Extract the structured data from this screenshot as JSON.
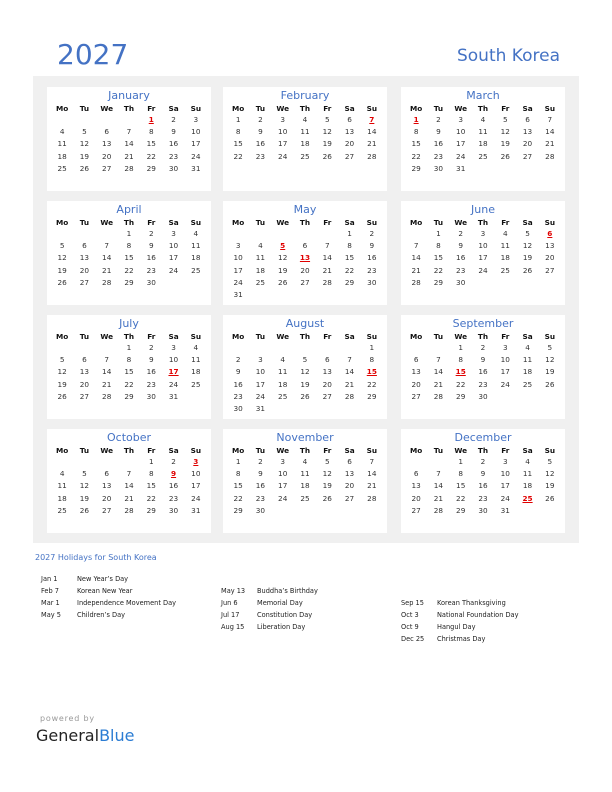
{
  "header": {
    "year": "2027",
    "country": "South Korea"
  },
  "colors": {
    "accent": "#4472c4",
    "holiday": "#e00000",
    "panel_bg": "#f0f0f0"
  },
  "weekdays": [
    "Mo",
    "Tu",
    "We",
    "Th",
    "Fr",
    "Sa",
    "Su"
  ],
  "months": [
    {
      "name": "January",
      "first_weekday": 4,
      "days": 31,
      "holidays": [
        1
      ]
    },
    {
      "name": "February",
      "first_weekday": 0,
      "days": 28,
      "holidays": [
        7
      ]
    },
    {
      "name": "March",
      "first_weekday": 0,
      "days": 31,
      "holidays": [
        1
      ]
    },
    {
      "name": "April",
      "first_weekday": 3,
      "days": 30,
      "holidays": []
    },
    {
      "name": "May",
      "first_weekday": 5,
      "days": 31,
      "holidays": [
        5,
        13
      ]
    },
    {
      "name": "June",
      "first_weekday": 1,
      "days": 30,
      "holidays": [
        6
      ]
    },
    {
      "name": "July",
      "first_weekday": 3,
      "days": 31,
      "holidays": [
        17
      ]
    },
    {
      "name": "August",
      "first_weekday": 6,
      "days": 31,
      "holidays": [
        15
      ]
    },
    {
      "name": "September",
      "first_weekday": 2,
      "days": 30,
      "holidays": [
        15
      ]
    },
    {
      "name": "October",
      "first_weekday": 4,
      "days": 31,
      "holidays": [
        3,
        9
      ]
    },
    {
      "name": "November",
      "first_weekday": 0,
      "days": 30,
      "holidays": []
    },
    {
      "name": "December",
      "first_weekday": 2,
      "days": 31,
      "holidays": [
        25
      ]
    }
  ],
  "holidays_section": {
    "title": "2027 Holidays for South Korea",
    "columns": [
      [
        {
          "date": "Jan 1",
          "name": "New Year’s Day"
        },
        {
          "date": "Feb 7",
          "name": "Korean New Year"
        },
        {
          "date": "Mar 1",
          "name": "Independence Movement Day"
        },
        {
          "date": "May 5",
          "name": "Children’s Day"
        }
      ],
      [
        {
          "date": "May 13",
          "name": "Buddha’s Birthday"
        },
        {
          "date": "Jun 6",
          "name": "Memorial Day"
        },
        {
          "date": "Jul 17",
          "name": "Constitution Day"
        },
        {
          "date": "Aug 15",
          "name": "Liberation Day"
        }
      ],
      [
        {
          "date": "Sep 15",
          "name": "Korean Thanksgiving"
        },
        {
          "date": "Oct 3",
          "name": "National Foundation Day"
        },
        {
          "date": "Oct 9",
          "name": "Hangul Day"
        },
        {
          "date": "Dec 25",
          "name": "Christmas Day"
        }
      ]
    ]
  },
  "footer": {
    "powered_by": "powered by",
    "brand_part1": "General",
    "brand_part2": "Blue"
  }
}
